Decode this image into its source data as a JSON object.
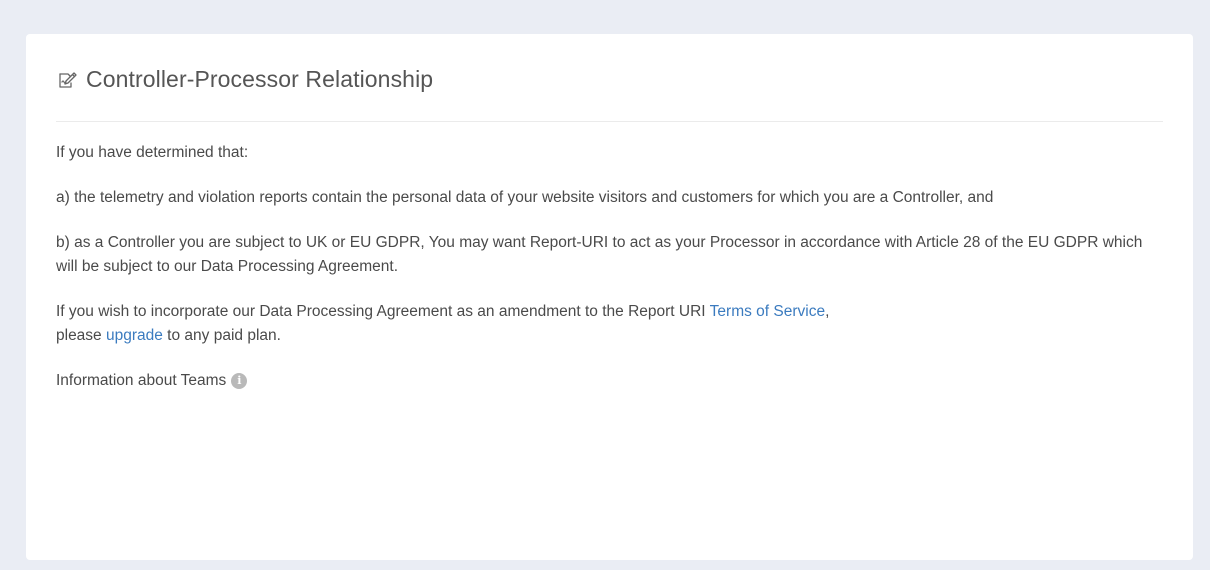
{
  "panel": {
    "title": "Controller-Processor Relationship",
    "header_icon": "edit-icon",
    "intro": "If you have determined that:",
    "point_a": "a) the telemetry and violation reports contain the personal data of your website visitors and customers for which you are a Controller, and",
    "point_b": "b) as a Controller you are subject to UK or EU GDPR, You may want Report-URI to act as your Processor in accordance with Article 28 of the EU GDPR which will be subject to our Data Processing Agreement.",
    "incorporate": {
      "before_tos": "If you wish to incorporate our Data Processing Agreement as an amendment to the Report URI ",
      "tos_link": "Terms of Service",
      "after_tos": ",",
      "before_upgrade": " please ",
      "upgrade_link": "upgrade",
      "after_upgrade": " to any paid plan."
    },
    "teams_info": "Information about Teams",
    "info_icon_glyph": "i"
  },
  "colors": {
    "page_background": "#eaedf4",
    "panel_background": "#ffffff",
    "link": "#3b7bbf",
    "text": "#4a4a4a"
  }
}
